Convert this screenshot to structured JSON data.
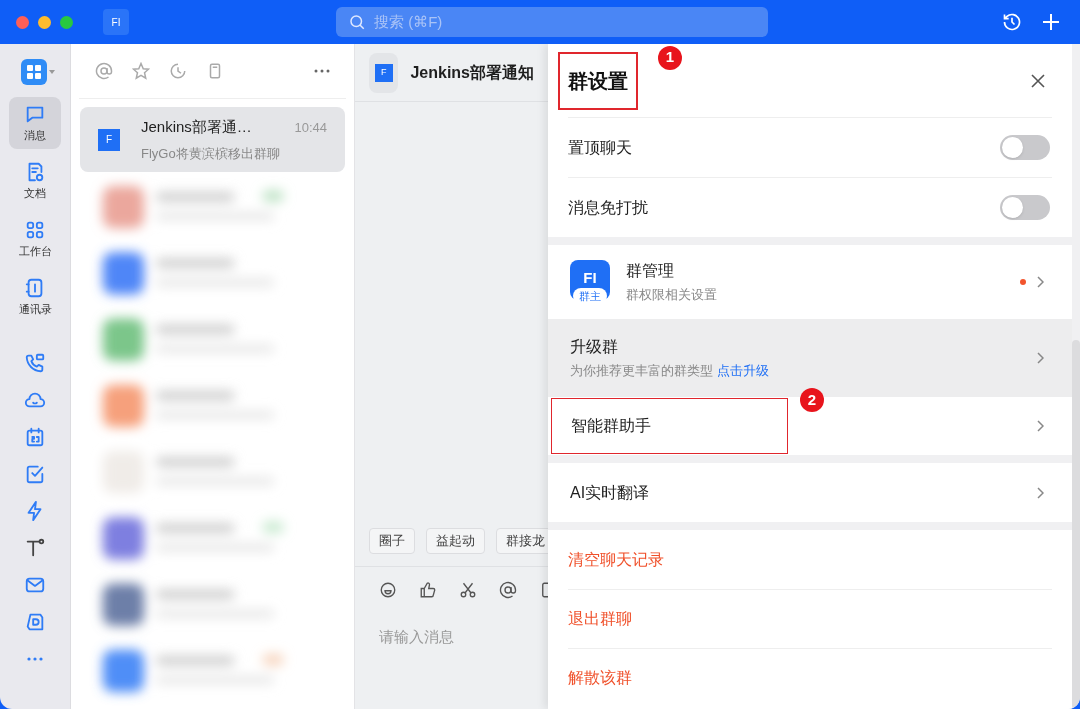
{
  "window": {
    "app_badge": "FI",
    "search": {
      "placeholder": "搜索 (⌘F)"
    }
  },
  "nav": {
    "items": [
      {
        "kind": "chat",
        "label": "消息",
        "selected": true
      },
      {
        "kind": "doc",
        "label": "文档",
        "selected": false
      },
      {
        "kind": "apps",
        "label": "工作台",
        "selected": false
      },
      {
        "kind": "contacts",
        "label": "通讯录",
        "selected": false
      }
    ]
  },
  "chat_list": {
    "items": [
      {
        "avatar": "F",
        "title": "Jenkins部署通…",
        "time": "10:44",
        "preview": "FlyGo将黄滨槟移出群聊",
        "selected": true
      }
    ]
  },
  "chat": {
    "avatar": "F",
    "title": "Jenkins部署通知",
    "quick_actions": [
      "圈子",
      "益起动",
      "群接龙"
    ],
    "input": {
      "placeholder": "请输入消息"
    }
  },
  "settings": {
    "title": "群设置",
    "annotation": "1",
    "toggles": [
      {
        "label": "置顶聊天",
        "on": false
      },
      {
        "label": "消息免打扰",
        "on": false
      }
    ],
    "manage": {
      "avatar": "FI",
      "badge": "群主",
      "title": "群管理",
      "subtitle": "群权限相关设置",
      "unread": true
    },
    "upgrade": {
      "title": "升级群",
      "subtitle": "为你推荐更丰富的群类型",
      "link": "点击升级"
    },
    "assistant": {
      "title": "智能群助手",
      "annotation": "2"
    },
    "translate": {
      "title": "AI实时翻译"
    },
    "danger_actions": [
      "清空聊天记录",
      "退出群聊",
      "解散该群"
    ]
  }
}
